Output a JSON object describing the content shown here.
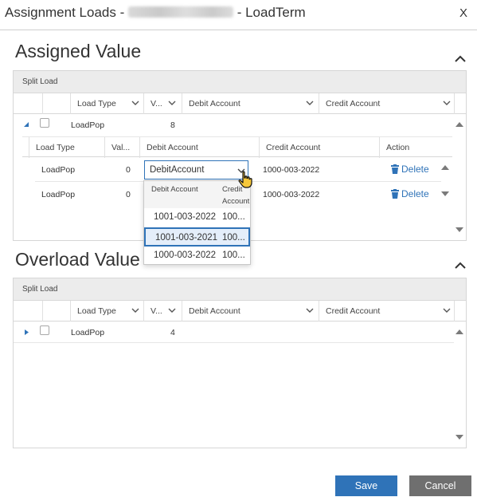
{
  "dialog": {
    "title_prefix": "Assignment Loads - ",
    "title_suffix": " - LoadTerm",
    "close_label": "X"
  },
  "assigned": {
    "title": "Assigned Value",
    "group_bar": "Split Load",
    "headers": {
      "load_type": "Load Type",
      "value": "V...",
      "debit": "Debit Account",
      "credit": "Credit Account"
    },
    "parent_row": {
      "load_type": "LoadPop",
      "value": "8"
    },
    "sub_headers": {
      "load_type": "Load Type",
      "value": "Val...",
      "debit": "Debit Account",
      "credit": "Credit Account",
      "action": "Action"
    },
    "sub_rows": [
      {
        "load_type": "LoadPop",
        "value": "0",
        "debit": "DebitAccount",
        "credit": "1000-003-2022",
        "action": "Delete"
      },
      {
        "load_type": "LoadPop",
        "value": "0",
        "credit": "1000-003-2022",
        "action": "Delete"
      }
    ]
  },
  "dropdown": {
    "col_debit": "Debit Account",
    "col_credit_1": "Credit",
    "col_credit_2": "Account",
    "options": [
      {
        "debit": "1001-003-2022",
        "credit": "100..."
      },
      {
        "debit": "1001-003-2021",
        "credit": "100..."
      },
      {
        "debit": "1000-003-2022",
        "credit": "100..."
      }
    ],
    "selected_index": 1
  },
  "overload": {
    "title": "Overload Value",
    "group_bar": "Split Load",
    "headers": {
      "load_type": "Load Type",
      "value": "V...",
      "debit": "Debit Account",
      "credit": "Credit Account"
    },
    "parent_row": {
      "load_type": "LoadPop",
      "value": "4"
    }
  },
  "footer": {
    "save_label": "Save",
    "cancel_label": "Cancel"
  },
  "colors": {
    "accent": "#2f73b8",
    "cancel": "#6f6f6f",
    "selected_bg": "#e4eefa"
  }
}
